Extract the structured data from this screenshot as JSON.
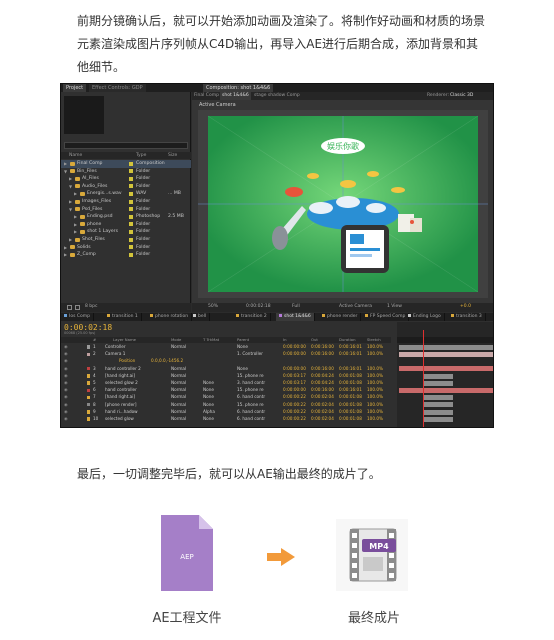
{
  "intro_text": "前期分镜确认后，就可以开始添加动画及渲染了。将制作好动画和材质的场景元素渲染成图片序列帧从C4D输出，再导入AE进行后期合成，添加背景和其他细节。",
  "closing_text": "最后，一切调整完毕后，就可以从AE输出最终的成片了。",
  "screenshot": {
    "project_tab": "Project",
    "effect_controls_tab": "Effect Controls: GDP",
    "comp_tab": "Composition: shot 1&4&6",
    "comp_subtabs": [
      "Final Comp",
      "shot 1&4&6",
      "stage shadow Comp"
    ],
    "renderer_label": "Renderer:",
    "renderer_value": "Classic 3D",
    "active_camera": "Active Camera",
    "scene_badge": "娱乐你歌",
    "project_columns": [
      "Name",
      "Type",
      "Size"
    ],
    "project_items": [
      {
        "name": "Final Comp",
        "type": "Composition",
        "size": "",
        "indent": 0,
        "expanded": false,
        "selected": true
      },
      {
        "name": "Bin_Files",
        "type": "Folder",
        "size": "",
        "indent": 0,
        "expanded": true,
        "selected": false
      },
      {
        "name": "AI_Files",
        "type": "Folder",
        "size": "",
        "indent": 1,
        "expanded": false,
        "selected": false
      },
      {
        "name": "Audio_Files",
        "type": "Folder",
        "size": "",
        "indent": 1,
        "expanded": true,
        "selected": false
      },
      {
        "name": "Energis...s.wav",
        "type": "WAV",
        "size": "... MB",
        "indent": 2,
        "expanded": false,
        "selected": false
      },
      {
        "name": "Images_Files",
        "type": "Folder",
        "size": "",
        "indent": 1,
        "expanded": false,
        "selected": false
      },
      {
        "name": "Psd_Files",
        "type": "Folder",
        "size": "",
        "indent": 1,
        "expanded": true,
        "selected": false
      },
      {
        "name": "Ending.psd",
        "type": "Photoshop",
        "size": "2.5 MB",
        "indent": 2,
        "expanded": false,
        "selected": false
      },
      {
        "name": "phone",
        "type": "Folder",
        "size": "",
        "indent": 2,
        "expanded": false,
        "selected": false
      },
      {
        "name": "shot 1 Layers",
        "type": "Folder",
        "size": "",
        "indent": 2,
        "expanded": false,
        "selected": false
      },
      {
        "name": "Shot_Files",
        "type": "Folder",
        "size": "",
        "indent": 1,
        "expanded": false,
        "selected": false
      },
      {
        "name": "Solids",
        "type": "Folder",
        "size": "",
        "indent": 0,
        "expanded": false,
        "selected": false
      },
      {
        "name": "Z_Comp",
        "type": "Folder",
        "size": "",
        "indent": 0,
        "expanded": false,
        "selected": false
      }
    ],
    "project_bpc": "8 bpc",
    "comp_toolbar": {
      "zoom": "50%",
      "time": "0:00:02:18",
      "quality": "Full",
      "view": "Active Camera",
      "views": "1 View",
      "exposure": "+0.0"
    },
    "timeline_tabs": [
      "Ios Comp",
      "transition 1",
      "phone rotation",
      "bell",
      "transition 2",
      "shot 1&4&6",
      "phone render",
      "FP Speed Comp",
      "Ending Logo",
      "transition 3"
    ],
    "timecode": "0:00:02:18",
    "fps_label": "00068 (25.00 fps)",
    "timeline_columns": [
      "#",
      "Layer Name",
      "Mode",
      "T TrkMat",
      "Parent",
      "In",
      "Out",
      "Duration",
      "Stretch"
    ],
    "layers": [
      {
        "num": "1",
        "name": "Controller",
        "mode": "Normal",
        "trkmat": "",
        "parent": "None",
        "in": "0:00:00:00",
        "out": "0:00:16:00",
        "dur": "0:00:16:01",
        "stretch": "100.0%",
        "color": "#9a9a9a"
      },
      {
        "num": "2",
        "name": "Camera 1",
        "mode": "",
        "trkmat": "",
        "parent": "1. Controller",
        "in": "0:00:00:00",
        "out": "0:00:16:00",
        "dur": "0:00:16:01",
        "stretch": "100.0%",
        "color": "#c0a0a0"
      },
      {
        "num": "",
        "name": "Position",
        "mode": "0.0,0.0,-1456.2",
        "trkmat": "",
        "parent": "",
        "in": "",
        "out": "",
        "dur": "",
        "stretch": "",
        "color": "",
        "sub": true
      },
      {
        "num": "3",
        "name": "hand controller 2",
        "mode": "Normal",
        "trkmat": "",
        "parent": "None",
        "in": "0:00:00:00",
        "out": "0:00:16:00",
        "dur": "0:00:16:01",
        "stretch": "100.0%",
        "color": "#c04040"
      },
      {
        "num": "4",
        "name": "[hand right.ai]",
        "mode": "Normal",
        "trkmat": "",
        "parent": "15. phone re",
        "in": "0:00:03:17",
        "out": "0:00:04:24",
        "dur": "0:00:01:08",
        "stretch": "100.0%",
        "color": "#d9a93b"
      },
      {
        "num": "5",
        "name": "selected glow 2",
        "mode": "Normal",
        "trkmat": "None",
        "parent": "3. hand contr",
        "in": "0:00:03:17",
        "out": "0:00:04:24",
        "dur": "0:00:01:08",
        "stretch": "100.0%",
        "color": "#d9a93b"
      },
      {
        "num": "6",
        "name": "hand controller",
        "mode": "Normal",
        "trkmat": "None",
        "parent": "15. phone re",
        "in": "0:00:00:00",
        "out": "0:00:16:00",
        "dur": "0:00:16:01",
        "stretch": "100.0%",
        "color": "#c04040"
      },
      {
        "num": "7",
        "name": "[hand right.ai]",
        "mode": "Normal",
        "trkmat": "None",
        "parent": "6. hand contr",
        "in": "0:00:00:22",
        "out": "0:00:02:04",
        "dur": "0:00:01:08",
        "stretch": "100.0%",
        "color": "#d9a93b"
      },
      {
        "num": "8",
        "name": "[phone render]",
        "mode": "Normal",
        "trkmat": "None",
        "parent": "15. phone re",
        "in": "0:00:00:22",
        "out": "0:00:02:04",
        "dur": "0:00:01:08",
        "stretch": "100.0%",
        "color": "#888888"
      },
      {
        "num": "9",
        "name": "hand ri...hadow",
        "mode": "Normal",
        "trkmat": "Alpha",
        "parent": "6. hand contr",
        "in": "0:00:00:22",
        "out": "0:00:02:04",
        "dur": "0:00:01:08",
        "stretch": "100.0%",
        "color": "#d9a93b"
      },
      {
        "num": "10",
        "name": "selected glow",
        "mode": "Normal",
        "trkmat": "None",
        "parent": "6. hand contr",
        "in": "0:00:00:22",
        "out": "0:00:02:04",
        "dur": "0:00:01:08",
        "stretch": "100.0%",
        "color": "#d9a93b"
      }
    ]
  },
  "aep_icon_text": "AEP",
  "mp4_icon_text": "MP4",
  "caption_aep": "AE工程文件",
  "caption_mp4": "最终成片",
  "colors": {
    "accent_orange": "#f29a3a",
    "aep_purple": "#a57fc8",
    "mp4_purple": "#7a4e9c",
    "scene_green": "#38b458",
    "ae_timecode": "#e7b43a"
  }
}
